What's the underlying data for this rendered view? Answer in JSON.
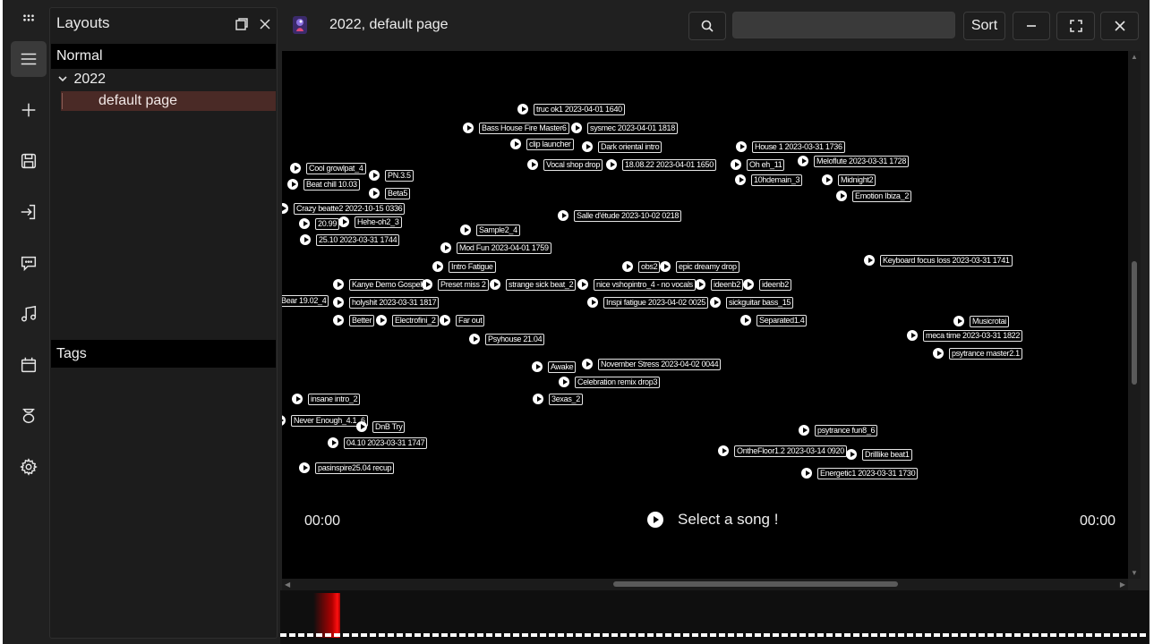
{
  "layouts_panel": {
    "title": "Layouts",
    "normal_label": "Normal",
    "folder_label": "2022",
    "page_label": "default page",
    "tags_label": "Tags"
  },
  "header": {
    "title": "2022, default page",
    "sort_label": "Sort",
    "search_value": ""
  },
  "player": {
    "time_left": "00:00",
    "time_right": "00:00",
    "status": "Select a song !"
  },
  "songs": [
    "truc ok1 2023-04-01 1640",
    "Bass House Fire Master6",
    "sysmec 2023-04-01 1818",
    "clip launcher",
    "Dark oriental intro",
    "House 1 2023-03-31 1736",
    "Vocal shop drop",
    "18.08.22 2023-04-01 1650",
    "Oh eh_11",
    "Meloflute 2023-03-31 1728",
    "Cool growlpat_4",
    "PN.3.5",
    "10hdemain_3",
    "Midnight2",
    "Beat chill 10.03",
    "Beta5",
    "Emotion Ibiza_2",
    "Crazy beatte2 2022-10-15 0336",
    "Salle d'étude 2023-10-02 0218",
    "20.99",
    "Hehe-oh2_3",
    "Sample2_4",
    "25.10 2023-03-31 1744",
    "Mod Fun 2023-04-01 1759",
    "Keyboard focus loss 2023-03-31 1741",
    "Intro Fatigue",
    "obs2",
    "epic dreamy drop",
    "Kanye Demo Gospel",
    "Preset miss 2",
    "strange sick beat_2",
    "nice vshopintro_4 - no vocals",
    "ideenb2",
    "ideenb2",
    "Bear 19.02_4",
    "holyshit 2023-03-31 1817",
    "Inspi fatigue 2023-04-02 0025",
    "sickguitar bass_15",
    "Better",
    "Electrofini_2",
    "Far out",
    "Separated1.4",
    "Musicrotai",
    "meca time 2023-03-31 1822",
    "Psyhouse 21.04",
    "psytrance master2.1",
    "Awake",
    "November Stress 2023-04-02 0044",
    "Celebration remix drop3",
    "insane intro_2",
    "3exas_2",
    "Never Enough_4.1_6",
    "DnB Try",
    "psytrance fun8_6",
    "04.10 2023-03-31 1747",
    "OntheFloor1.2 2023-03-14 0920",
    "Drilllike beat1",
    "pasinspire25.04 recup",
    "Energetic1 2023-03-31 1730"
  ]
}
